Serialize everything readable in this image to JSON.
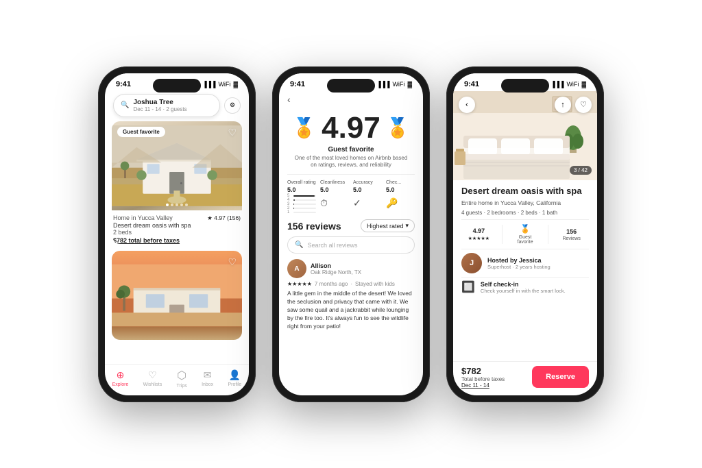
{
  "scene": {
    "background": "#f0f0f0"
  },
  "phone1": {
    "time": "9:41",
    "search": {
      "main": "Joshua Tree",
      "sub": "Dec 11 - 14 · 2 guests"
    },
    "listing1": {
      "badge": "Guest favorite",
      "location": "Home in Yucca Valley",
      "rating": "★ 4.97 (156)",
      "name": "Desert dream oasis with spa",
      "beds": "2 beds",
      "price": "$782 total before taxes"
    },
    "listing2": {},
    "nav": {
      "explore": "Explore",
      "wishlists": "Wishlists",
      "trips": "Trips",
      "inbox": "Inbox",
      "profile": "Profile"
    }
  },
  "phone2": {
    "time": "9:41",
    "rating": "4.97",
    "guest_favorite_label": "Guest favorite",
    "guest_favorite_sub": "One of the most loved homes on Airbnb based on ratings, reviews, and reliability",
    "metrics": {
      "overall": {
        "label": "Overall rating",
        "value": "5.0"
      },
      "cleanliness": {
        "label": "Cleanliness",
        "value": "5.0"
      },
      "accuracy": {
        "label": "Accuracy",
        "value": "5.0"
      },
      "checkin": {
        "label": "Chec...",
        "value": "5.0"
      }
    },
    "reviews_count": "156 reviews",
    "sort_label": "Highest rated",
    "search_placeholder": "Search all reviews",
    "reviewer": {
      "name": "Allison",
      "location": "Oak Ridge North, TX",
      "stars": "★★★★★",
      "time": "7 months ago",
      "stayed": "Stayed with kids",
      "text": "A little gem in the middle of the desert! We loved the seclusion and privacy that came with it. We saw some quail and a jackrabbit while lounging by the fire too. It's always fun to see the wildlife right from your patio!"
    }
  },
  "phone3": {
    "time": "9:41",
    "photo_count": "3 / 42",
    "title": "Desert dream oasis with spa",
    "subtitle": "Entire home in Yucca Valley, California",
    "amenities": "4 guests · 2 bedrooms · 2 beds · 1 bath",
    "stats": {
      "rating": {
        "val": "4.97",
        "stars": "★★★★★"
      },
      "guest_fav": "Guest\nfavorite",
      "reviews": {
        "count": "156",
        "label": "Reviews"
      }
    },
    "host": {
      "name": "Hosted by Jessica",
      "meta": "Superhost · 2 years hosting",
      "initial": "J"
    },
    "checkin": {
      "title": "Self check-in",
      "sub": "Check yourself in with the smart lock."
    },
    "price": {
      "value": "$782",
      "label": "Total before taxes",
      "dates": "Dec 11 - 14"
    },
    "reserve_label": "Reserve"
  }
}
